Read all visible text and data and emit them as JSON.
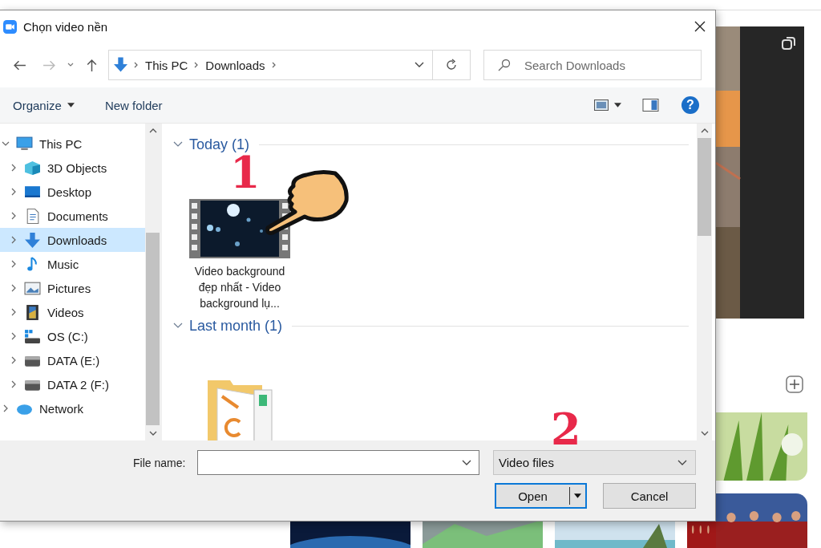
{
  "window": {
    "title": "Chọn video nền"
  },
  "nav": {
    "path": [
      "This PC",
      "Downloads"
    ],
    "search": {
      "placeholder": "Search Downloads"
    }
  },
  "toolbar": {
    "organize": "Organize",
    "new_folder": "New folder",
    "help": "?"
  },
  "tree": [
    {
      "label": "This PC",
      "kind": "pc",
      "expanded": true,
      "selected": false,
      "children": [
        {
          "label": "3D Objects",
          "kind": "cube",
          "expanded": false,
          "selected": false
        },
        {
          "label": "Desktop",
          "kind": "desktop",
          "expanded": false,
          "selected": false
        },
        {
          "label": "Documents",
          "kind": "document",
          "expanded": false,
          "selected": false
        },
        {
          "label": "Downloads",
          "kind": "download",
          "expanded": false,
          "selected": true
        },
        {
          "label": "Music",
          "kind": "music",
          "expanded": false,
          "selected": false
        },
        {
          "label": "Pictures",
          "kind": "pictures",
          "expanded": false,
          "selected": false
        },
        {
          "label": "Videos",
          "kind": "videos",
          "expanded": false,
          "selected": false
        },
        {
          "label": "OS (C:)",
          "kind": "system",
          "expanded": false,
          "selected": false
        },
        {
          "label": "DATA (E:)",
          "kind": "drive",
          "expanded": false,
          "selected": false
        },
        {
          "label": "DATA 2 (F:)",
          "kind": "drive",
          "expanded": false,
          "selected": false
        }
      ]
    },
    {
      "label": "Network",
      "kind": "network",
      "expanded": false,
      "selected": false
    }
  ],
  "groups": [
    {
      "title": "Today (1)",
      "expanded": true,
      "files": [
        {
          "kind": "video",
          "name": "Video background đẹp nhất - Video background lụ..."
        }
      ]
    },
    {
      "title": "Last month (1)",
      "expanded": true,
      "files": [
        {
          "kind": "folder"
        }
      ]
    }
  ],
  "file_name": {
    "label": "File name:"
  },
  "filter": {
    "value": "Video files"
  },
  "buttons": {
    "open": "Open",
    "cancel": "Cancel"
  },
  "annotations": [
    {
      "text": "1"
    },
    {
      "text": "2"
    }
  ]
}
